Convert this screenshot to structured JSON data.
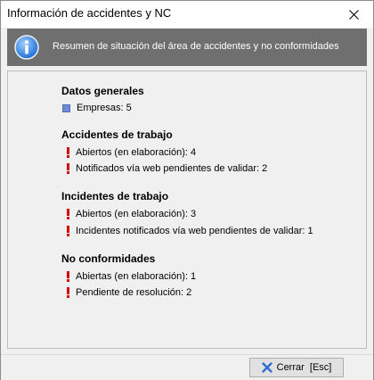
{
  "window": {
    "title": "Información de accidentes y NC",
    "close_icon": "close-icon"
  },
  "banner": {
    "icon": "info-icon",
    "text": "Resumen de situación del área de accidentes y no conformidades"
  },
  "sections": [
    {
      "title": "Datos generales",
      "items": [
        {
          "icon": "blue-square-icon",
          "text": "Empresas: 5"
        }
      ]
    },
    {
      "title": "Accidentes de trabajo",
      "items": [
        {
          "icon": "exclamation-icon",
          "text": "Abiertos (en elaboración): 4"
        },
        {
          "icon": "exclamation-icon",
          "text": "Notificados vía web pendientes de validar: 2"
        }
      ]
    },
    {
      "title": "Incidentes de trabajo",
      "items": [
        {
          "icon": "exclamation-icon",
          "text": "Abiertos (en elaboración): 3"
        },
        {
          "icon": "exclamation-icon",
          "text": "Incidentes notificados vía web pendientes de validar: 1"
        }
      ]
    },
    {
      "title": "No conformidades",
      "items": [
        {
          "icon": "exclamation-icon",
          "text": "Abiertas (en elaboración): 1"
        },
        {
          "icon": "exclamation-icon",
          "text": "Pendiente de resolución: 2"
        }
      ]
    }
  ],
  "footer": {
    "close_button_label": "Cerrar  [Esc]",
    "close_button_icon": "x-icon"
  },
  "colors": {
    "banner_bg": "#6f6f6f",
    "alert_red": "#d40000",
    "bullet_blue": "#6c8ed6",
    "close_x_blue": "#2f6fd0"
  }
}
